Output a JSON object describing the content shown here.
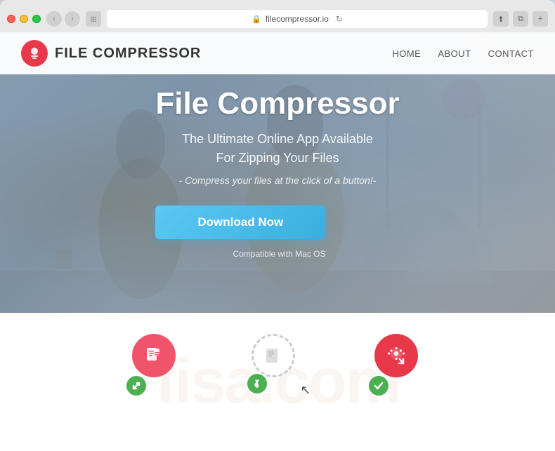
{
  "browser": {
    "address": "filecompressor.io",
    "tab_icon": "🗜"
  },
  "navbar": {
    "brand_name": "FILE COMPRESSOR",
    "logo_icon": "🏠",
    "nav_links": [
      {
        "label": "HOME",
        "id": "home"
      },
      {
        "label": "ABOUT",
        "id": "about"
      },
      {
        "label": "CONTACT",
        "id": "contact"
      }
    ]
  },
  "hero": {
    "title": "File Compressor",
    "subtitle_line1": "The Ultimate Online App Available",
    "subtitle_line2": "For Zipping Your Files",
    "tagline": "- Compress your files at the click of a button!-",
    "cta_label": "Download Now",
    "compatible_text": "Compatible with Mac OS"
  },
  "features": {
    "watermark": "fisa.com",
    "items": [
      {
        "id": "compress",
        "main_icon": "📄",
        "badge_icon": "↗",
        "badge_color": "green"
      },
      {
        "id": "drag-drop",
        "main_icon": "📋",
        "badge_icon": "👍",
        "badge_color": "green"
      },
      {
        "id": "download",
        "main_icon": "⬇",
        "badge_icon": "✓",
        "badge_color": "green"
      }
    ]
  }
}
